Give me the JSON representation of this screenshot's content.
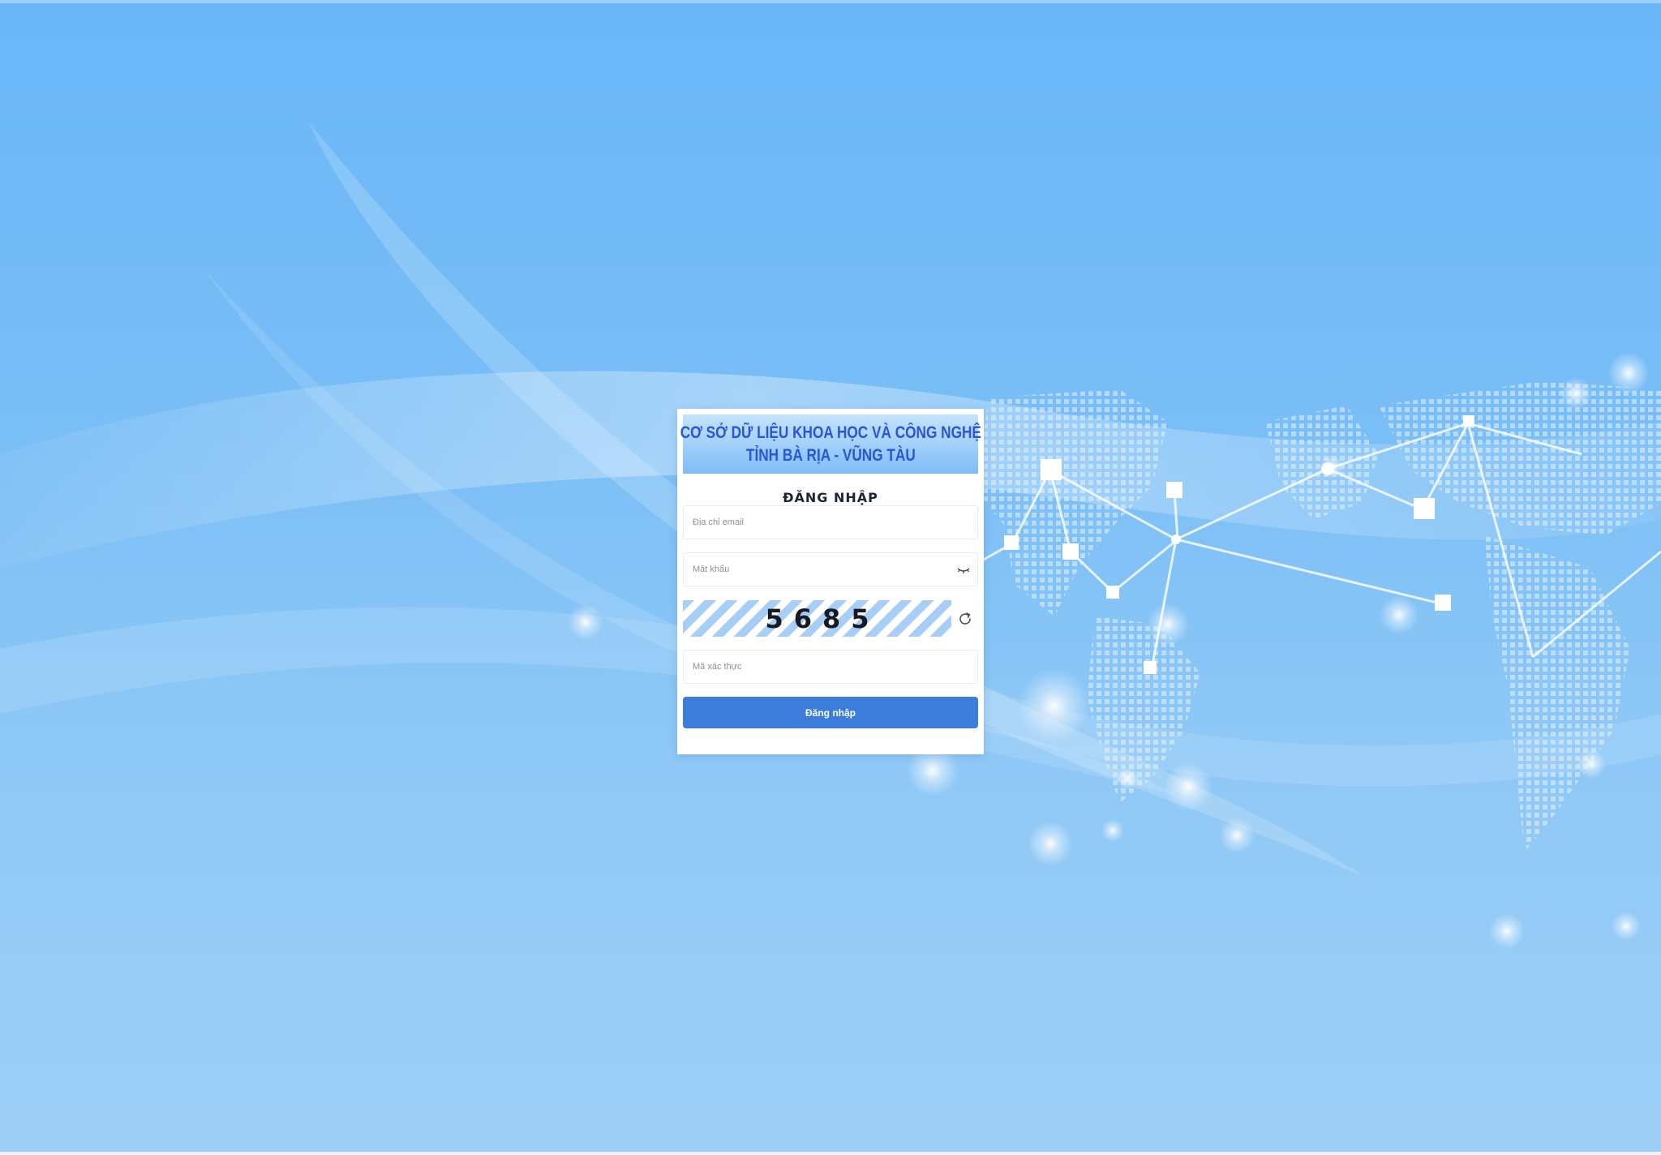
{
  "banner": {
    "line1": "CƠ SỞ DỮ LIỆU KHOA HỌC VÀ CÔNG NGHỆ",
    "line2": "TỈNH BÀ RỊA - VŨNG TÀU"
  },
  "login": {
    "title": "ĐĂNG NHẬP",
    "email_placeholder": "Địa chỉ email",
    "email_value": "",
    "password_placeholder": "Mật khẩu",
    "password_value": "",
    "captcha_code": "5685",
    "captcha_placeholder": "Mã xác thực",
    "captcha_value": "",
    "submit_label": "Đăng nhập"
  },
  "icons": {
    "password_toggle": "eye-closed-icon",
    "captcha_refresh": "refresh-icon"
  },
  "colors": {
    "primary": "#3c7ddc",
    "banner_text": "#2a55d4",
    "background": "#78bdf6"
  }
}
